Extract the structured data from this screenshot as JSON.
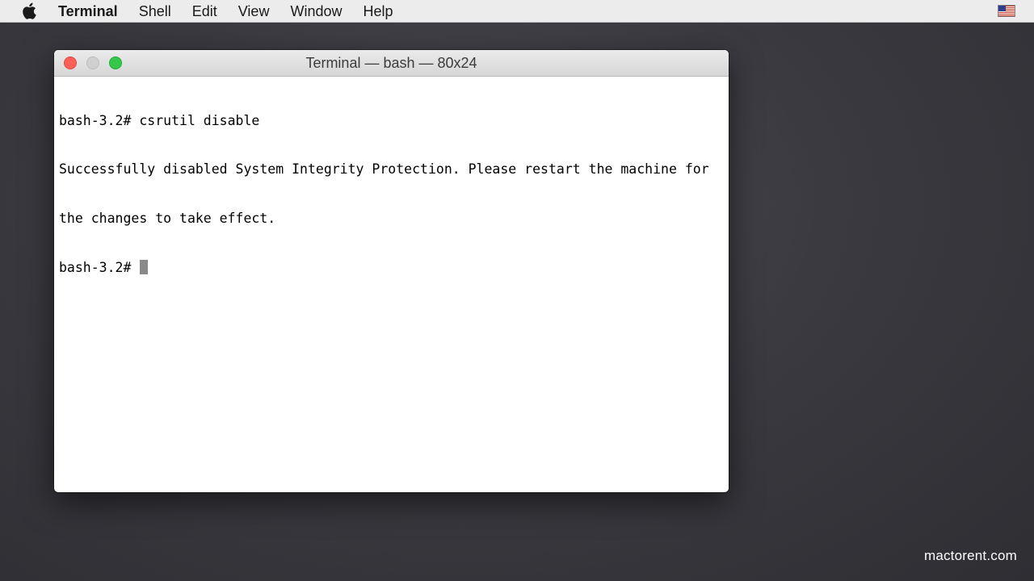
{
  "menubar": {
    "apple_icon": "apple-logo",
    "items": [
      "Terminal",
      "Shell",
      "Edit",
      "View",
      "Window",
      "Help"
    ],
    "input_source_icon": "us-flag"
  },
  "window": {
    "title": "Terminal — bash — 80x24",
    "lines": [
      "bash-3.2# csrutil disable",
      "Successfully disabled System Integrity Protection. Please restart the machine for",
      "the changes to take effect.",
      "bash-3.2# "
    ]
  },
  "watermark": "mactorent.com",
  "colors": {
    "close": "#fc5f57",
    "minimize": "#d0d0d0",
    "zoom": "#34c84a",
    "desktop": "#3a3a40"
  }
}
